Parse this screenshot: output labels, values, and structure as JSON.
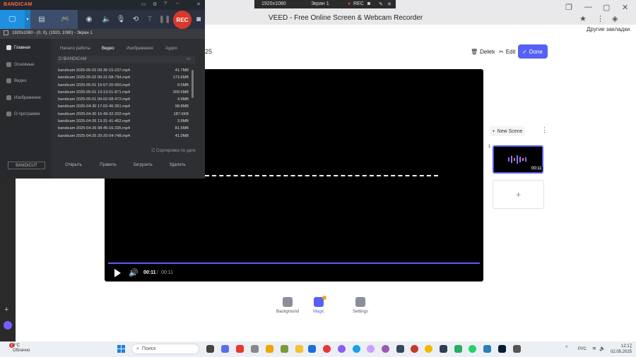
{
  "browser": {
    "tab_title": "VEED - Free Online Screen & Webcam Recorder",
    "other_bookmarks": "Другие закладки"
  },
  "rec_bar": {
    "resolution": "1920x1080",
    "screen": "Экран 1",
    "rec": "REC"
  },
  "veed": {
    "title_fragment": "025",
    "delete_label": "Delete",
    "edit_label": "Edit",
    "done_label": "Done",
    "time_current": "00:11",
    "time_separator": "/",
    "time_total": "00:11",
    "new_scene_label": "New Scene",
    "scene_index": "1",
    "scene_duration": "00:11",
    "tools": [
      {
        "label": "Background",
        "icon": "background-icon"
      },
      {
        "label": "Magic",
        "icon": "magic-icon"
      },
      {
        "label": "Settings",
        "icon": "settings-icon"
      }
    ],
    "accent_color": "#5561f3"
  },
  "bandicam": {
    "logo": "BANDICAM",
    "rec_label": "REC",
    "info_line": "1920x1080 - (0, 0), (1920, 1080) - Экран 1",
    "sidebar": [
      {
        "label": "Главная",
        "icon": "home-icon"
      },
      {
        "label": "Основные",
        "icon": "gear-icon"
      },
      {
        "label": "Видео",
        "icon": "video-icon"
      },
      {
        "label": "Изображение",
        "icon": "image-icon"
      },
      {
        "label": "О программе",
        "icon": "info-icon"
      }
    ],
    "bandicut_label": "BANDICUT",
    "tabs": [
      "Начало работы",
      "Видео",
      "Изображения",
      "Аудио"
    ],
    "path": "D:\\BANDICAM",
    "files": [
      {
        "name": "bandicam 2025-05-02 09-36-15-237.mp4",
        "size": "41.7MB"
      },
      {
        "name": "bandicam 2025-05-02 09-21-58-794.mp4",
        "size": "173.6MB"
      },
      {
        "name": "bandicam 2025-05-01 15-57-20-950.mp4",
        "size": "9.5MB"
      },
      {
        "name": "bandicam 2025-05-01 13-13-01-871.mp4",
        "size": "309.5MB"
      },
      {
        "name": "bandicam 2025-05-01 09-02-08-472.mp4",
        "size": "4.9MB"
      },
      {
        "name": "bandicam 2025-04-30 17-02-46-351.mp4",
        "size": "98.8MB"
      },
      {
        "name": "bandicam 2025-04-30 16-49-32-202.mp4",
        "size": "187.0KB"
      },
      {
        "name": "bandicam 2025-04-26 13-31-41-462.mp4",
        "size": "3.9MB"
      },
      {
        "name": "bandicam 2025-04-26 08-45-16-335.mp4",
        "size": "81.5MB"
      },
      {
        "name": "bandicam 2025-04-25 20-20-04-748.mp4",
        "size": "41.0MB"
      }
    ],
    "sort_label": "Сортировка по дате",
    "actions": [
      "Открыть",
      "Править",
      "Загрузить",
      "Удалить"
    ]
  },
  "taskbar": {
    "weather_temp": "3°C",
    "weather_desc": "Облачно",
    "weather_badge": "1",
    "search_placeholder": "Поиск",
    "language": "РУС",
    "time": "12:17",
    "date": "02.05.2025"
  }
}
